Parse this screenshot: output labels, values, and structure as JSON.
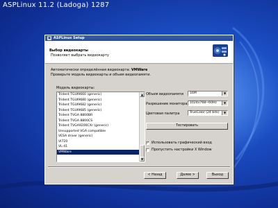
{
  "os": {
    "title": "ASPLinux 11.2 (Ladoga) 1287"
  },
  "window": {
    "title": "ASPLinux Setup",
    "header": {
      "title": "Выбор видеокарты",
      "subtitle": "Позволяет выбрать видеокарту"
    },
    "info_line1": "Автоматически определённая видеокарта: ",
    "detected_card": "VMWare",
    "info_line2": "Проверьте модель видеокарты и объем видеопамяти.",
    "model_label": "Модель видеокарты:",
    "models": [
      "Trident TGUI9660 (generic)",
      "Trident TGUI9680 (generic)",
      "Trident TGUI9682 (generic)",
      "Trident TGUI9685 (generic)",
      "Trident TVGA 8800BR",
      "Trident TVGA 8800CS",
      "Trident TVGA9200CXr (generic)",
      "Unsupported VGA compatible",
      "VESA driver (generic)",
      "VI720",
      "VL-41",
      "VMWare"
    ],
    "selected_model": "VMWare",
    "video_memory_label": "Объем видеопамяти",
    "video_memory_value": "16M",
    "monitor_res_label": "Разрешение монитора",
    "monitor_res_value": "1024x768~60Hz",
    "color_palette_label": "Цветовая палитра",
    "color_palette_value": "TrueColor (24 bits)",
    "test_button": "Тестировать",
    "graphical_login_label": "Использовать графический вход",
    "graphical_login_checked": true,
    "skip_x_label": "Пропустить настройки X Window",
    "skip_x_checked": false,
    "back_button": "< Назад",
    "next_button": "Далее >",
    "exit_button": "Выход"
  }
}
